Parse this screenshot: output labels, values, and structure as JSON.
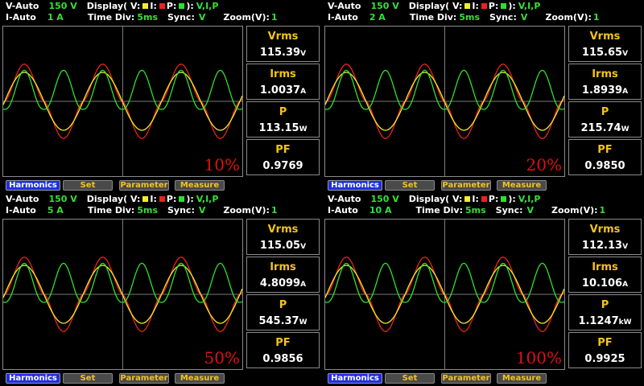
{
  "colors": {
    "voltage": "#f2ee2a",
    "current": "#ee2020",
    "power": "#2ee02e",
    "label": "#f4c31b",
    "accent": "#35e035",
    "load": "#e01010"
  },
  "legend": {
    "display_label": "Display( V:",
    "i_label": "I:",
    "p_label": "P:",
    "close": "):",
    "time_div_label": "Time Div:",
    "sync_label": "Sync:",
    "zoom_label": "Zoom(V):"
  },
  "buttons": [
    "Harmonics",
    "Set",
    "Parameter",
    "Measure"
  ],
  "measure_labels": [
    "Vrms",
    "Irms",
    "P",
    "PF"
  ],
  "panels": [
    {
      "v_mode": "V-Auto",
      "v_range": "150 V",
      "i_mode": "I-Auto",
      "i_range": "1 A",
      "display": "V,I,P",
      "time_div": "5ms",
      "sync": "V",
      "zoom": "1",
      "load": "10%",
      "vrms": "115.39",
      "vrms_unit": "V",
      "irms": "1.0037",
      "irms_unit": "A",
      "p": "113.15",
      "p_unit": "W",
      "pf": "0.9769"
    },
    {
      "v_mode": "V-Auto",
      "v_range": "150 V",
      "i_mode": "I-Auto",
      "i_range": "2 A",
      "display": "V,I,P",
      "time_div": "5ms",
      "sync": "V",
      "zoom": "1",
      "load": "20%",
      "vrms": "115.65",
      "vrms_unit": "V",
      "irms": "1.8939",
      "irms_unit": "A",
      "p": "215.74",
      "p_unit": "W",
      "pf": "0.9850"
    },
    {
      "v_mode": "V-Auto",
      "v_range": "150 V",
      "i_mode": "I-Auto",
      "i_range": "5 A",
      "display": "V,I,P",
      "time_div": "5ms",
      "sync": "V",
      "zoom": "1",
      "load": "50%",
      "vrms": "115.05",
      "vrms_unit": "V",
      "irms": "4.8099",
      "irms_unit": "A",
      "p": "545.37",
      "p_unit": "W",
      "pf": "0.9856"
    },
    {
      "v_mode": "V-Auto",
      "v_range": "150 V",
      "i_mode": "I-Auto",
      "i_range": "10 A",
      "display": "V,I,P",
      "time_div": "5ms",
      "sync": "V",
      "zoom": "1",
      "load": "100%",
      "vrms": "112.13",
      "vrms_unit": "V",
      "irms": "10.106",
      "irms_unit": "A",
      "p": "1.1247",
      "p_unit": "kW",
      "pf": "0.9925"
    }
  ]
}
